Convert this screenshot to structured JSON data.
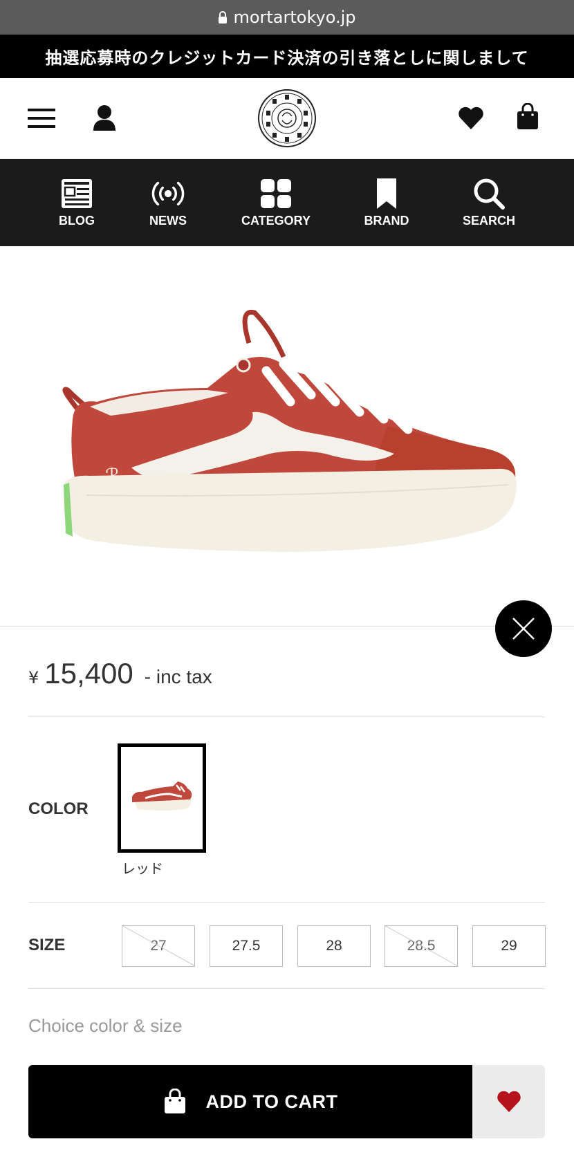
{
  "browser": {
    "url": "mortartokyo.jp"
  },
  "notice": {
    "text": "抽選応募時のクレジットカード決済の引き落としに関しまして"
  },
  "nav": {
    "blog": "BLOG",
    "news": "NEWS",
    "category": "CATEGORY",
    "brand": "BRAND",
    "search": "SEARCH"
  },
  "product": {
    "currency": "¥",
    "price": "15,400",
    "tax_label": "- inc tax",
    "color_label": "COLOR",
    "color_option": "レッド",
    "size_label": "SIZE",
    "sizes": [
      {
        "value": "27",
        "available": false
      },
      {
        "value": "27.5",
        "available": true
      },
      {
        "value": "28",
        "available": true
      },
      {
        "value": "28.5",
        "available": false
      },
      {
        "value": "29",
        "available": true
      }
    ],
    "choice_hint": "Choice color & size",
    "add_to_cart": "ADD TO CART"
  },
  "colors": {
    "accent_red": "#b5121b",
    "shoe_red": "#c0473b",
    "black": "#000000"
  },
  "icons": [
    "lock-icon",
    "hamburger-icon",
    "account-icon",
    "logo",
    "heart-icon",
    "bag-icon",
    "blog-icon",
    "news-icon",
    "category-icon",
    "brand-icon",
    "search-icon",
    "close-icon"
  ]
}
